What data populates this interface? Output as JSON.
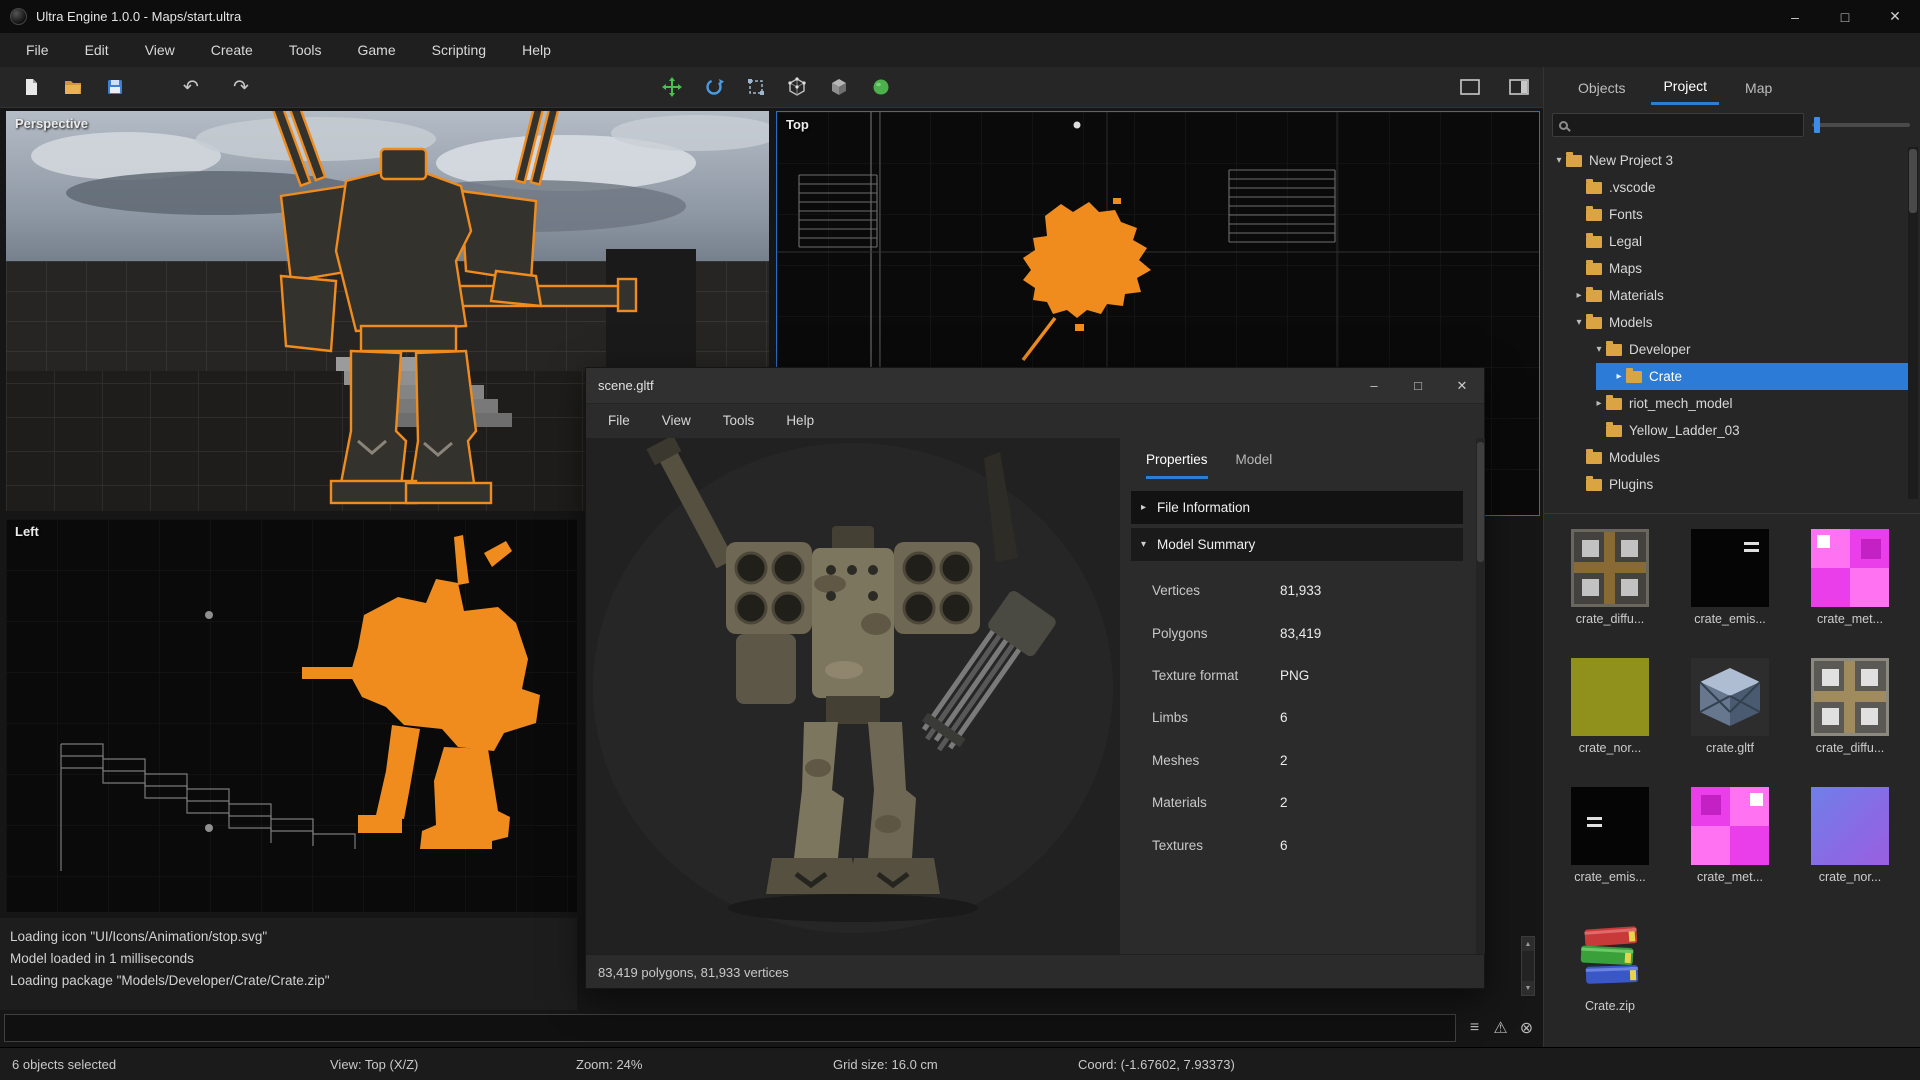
{
  "colors": {
    "accent": "#2d7dd2",
    "selection": "#f08c1e",
    "folder": "#d9a441"
  },
  "titlebar": {
    "title": "Ultra Engine 1.0.0 - Maps/start.ultra"
  },
  "icons": {
    "minimize": "–",
    "maximize": "□",
    "close": "✕",
    "undo": "↶",
    "redo": "↷",
    "list": "≡",
    "warning": "⚠",
    "dismiss": "⊗",
    "up": "▲",
    "down": "▼"
  },
  "menu": {
    "items": [
      "File",
      "Edit",
      "View",
      "Create",
      "Tools",
      "Game",
      "Scripting",
      "Help"
    ]
  },
  "viewports": {
    "perspective": {
      "label": "Perspective"
    },
    "top": {
      "label": "Top"
    },
    "left": {
      "label": "Left"
    }
  },
  "model_window": {
    "title": "scene.gltf",
    "menu": [
      "File",
      "View",
      "Tools",
      "Help"
    ],
    "tabs": [
      {
        "label": "Properties"
      },
      {
        "label": "Model"
      }
    ],
    "sections": [
      {
        "label": "File Information",
        "arrow": "▸"
      },
      {
        "label": "Model Summary",
        "arrow": "▾"
      }
    ],
    "summary": [
      {
        "label": "Vertices",
        "value": "81,933"
      },
      {
        "label": "Polygons",
        "value": "83,419"
      },
      {
        "label": "Texture format",
        "value": "PNG"
      },
      {
        "label": "Limbs",
        "value": "6"
      },
      {
        "label": "Meshes",
        "value": "2"
      },
      {
        "label": "Materials",
        "value": "2"
      },
      {
        "label": "Textures",
        "value": "6"
      }
    ],
    "status": "83,419 polygons, 81,933 vertices"
  },
  "right_panel": {
    "tabs": [
      {
        "label": "Objects"
      },
      {
        "label": "Project"
      },
      {
        "label": "Map"
      }
    ],
    "tree": [
      {
        "label": "New Project 3",
        "arrow": "▾"
      },
      {
        "label": ".vscode",
        "arrow": ""
      },
      {
        "label": "Fonts",
        "arrow": ""
      },
      {
        "label": "Legal",
        "arrow": ""
      },
      {
        "label": "Maps",
        "arrow": ""
      },
      {
        "label": "Materials",
        "arrow": "▸"
      },
      {
        "label": "Models",
        "arrow": "▾"
      },
      {
        "label": "Developer",
        "arrow": "▾"
      },
      {
        "label": "Crate",
        "arrow": "▸"
      },
      {
        "label": "riot_mech_model",
        "arrow": "▸"
      },
      {
        "label": "Yellow_Ladder_03",
        "arrow": ""
      },
      {
        "label": "Modules",
        "arrow": ""
      },
      {
        "label": "Plugins",
        "arrow": ""
      }
    ],
    "assets": [
      {
        "label": "crate_diffu..."
      },
      {
        "label": "crate_emis..."
      },
      {
        "label": "crate_met..."
      },
      {
        "label": "crate_nor..."
      },
      {
        "label": "crate.gltf"
      },
      {
        "label": "crate_diffu..."
      },
      {
        "label": "crate_emis..."
      },
      {
        "label": "crate_met..."
      },
      {
        "label": "crate_nor..."
      },
      {
        "label": "Crate.zip"
      }
    ]
  },
  "log": {
    "lines": [
      "Loading icon \"UI/Icons/Animation/stop.svg\"",
      "Model loaded in 1 milliseconds",
      "Loading package \"Models/Developer/Crate/Crate.zip\""
    ]
  },
  "status_bar": {
    "items": [
      "6 objects selected",
      "View: Top (X/Z)",
      "Zoom: 24%",
      "Grid size: 16.0 cm",
      "Coord: (-1.67602, 7.93373)"
    ]
  }
}
